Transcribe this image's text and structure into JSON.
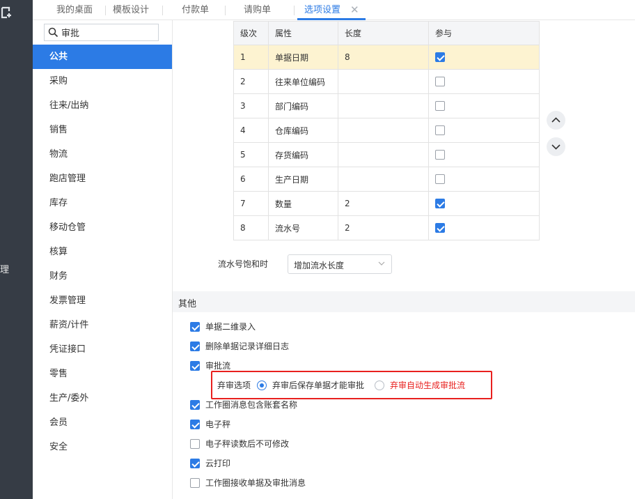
{
  "nav": {
    "partial_text": "理"
  },
  "tabs": [
    {
      "label": "我的桌面"
    },
    {
      "label": "模板设计"
    },
    {
      "label": "付款单"
    },
    {
      "label": "请购单"
    },
    {
      "label": "选项设置",
      "active": true
    }
  ],
  "search": {
    "value": "审批"
  },
  "sidebar": {
    "items": [
      {
        "label": "公共",
        "active": true
      },
      {
        "label": "采购"
      },
      {
        "label": "往来/出纳"
      },
      {
        "label": "销售"
      },
      {
        "label": "物流"
      },
      {
        "label": "跑店管理"
      },
      {
        "label": "库存"
      },
      {
        "label": "移动仓管"
      },
      {
        "label": "核算"
      },
      {
        "label": "财务"
      },
      {
        "label": "发票管理"
      },
      {
        "label": "薪资/计件"
      },
      {
        "label": "凭证接口"
      },
      {
        "label": "零售"
      },
      {
        "label": "生产/委外"
      },
      {
        "label": "会员"
      },
      {
        "label": "安全"
      }
    ]
  },
  "grid": {
    "headers": [
      "级次",
      "属性",
      "长度",
      "参与"
    ],
    "rows": [
      {
        "level": "1",
        "attr": "单据日期",
        "length": "8",
        "checked": true
      },
      {
        "level": "2",
        "attr": "往来单位编码",
        "length": "",
        "checked": false
      },
      {
        "level": "3",
        "attr": "部门编码",
        "length": "",
        "checked": false
      },
      {
        "level": "4",
        "attr": "仓库编码",
        "length": "",
        "checked": false
      },
      {
        "level": "5",
        "attr": "存货编码",
        "length": "",
        "checked": false
      },
      {
        "level": "6",
        "attr": "生产日期",
        "length": "",
        "checked": false
      },
      {
        "level": "7",
        "attr": "数量",
        "length": "2",
        "checked": true
      },
      {
        "level": "8",
        "attr": "流水号",
        "length": "2",
        "checked": true
      }
    ]
  },
  "saturation": {
    "label": "流水号饱和时",
    "value": "增加流水长度"
  },
  "other": {
    "title": "其他",
    "options": [
      {
        "label": "单据二维录入",
        "checked": true
      },
      {
        "label": "删除单据记录详细日志",
        "checked": true
      },
      {
        "label": "审批流",
        "checked": true
      },
      {
        "label": "工作圈消息包含账套名称",
        "checked": true
      },
      {
        "label": "电子秤",
        "checked": true
      },
      {
        "label": "电子秤读数后不可修改",
        "checked": false
      },
      {
        "label": "云打印",
        "checked": true
      },
      {
        "label": "工作圈接收单据及审批消息",
        "checked": false
      }
    ],
    "abandon": {
      "label": "弃审选项",
      "option1": "弃审后保存单据才能审批",
      "option2": "弃审自动生成审批流"
    }
  },
  "colors": {
    "accent": "#2c7be5",
    "highlight": "#e8201e",
    "selected_row": "#fdf3d1"
  }
}
